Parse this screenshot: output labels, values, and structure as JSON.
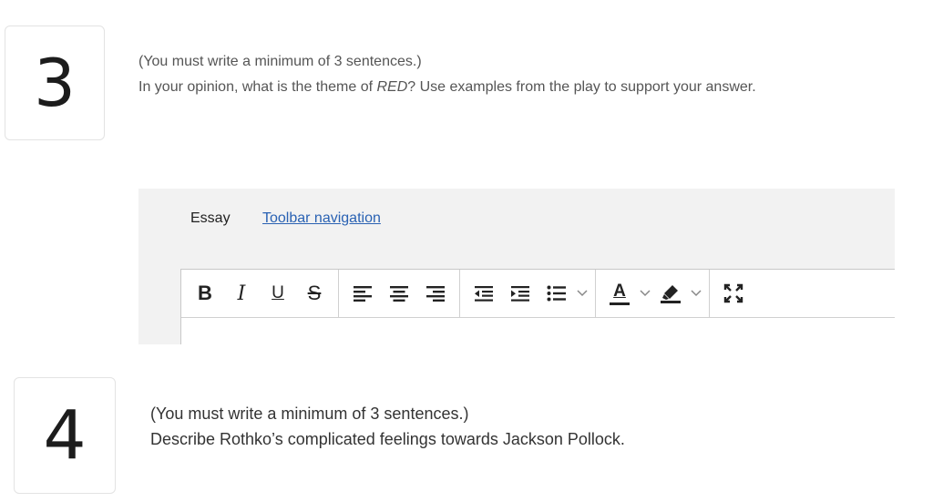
{
  "questions": [
    {
      "number": "3",
      "note": "(You must write a minimum of 3 sentences.)",
      "prompt_before": "In your opinion, what is the theme of ",
      "prompt_italic": "RED",
      "prompt_after": "? Use examples from the play to support your answer."
    },
    {
      "number": "4",
      "note": "(You must write a minimum of 3 sentences.)",
      "prompt": "Describe Rothko’s complicated feelings towards Jackson Pollock."
    }
  ],
  "editor": {
    "label": "Essay",
    "toolbar_link": "Toolbar navigation",
    "bold_glyph": "B",
    "italic_glyph": "I",
    "underline_glyph": "U",
    "strike_glyph": "S",
    "font_color_glyph": "A"
  },
  "colors": {
    "link": "#2a62b3",
    "panel": "#f2f2f2",
    "border": "#d0d0d0"
  }
}
